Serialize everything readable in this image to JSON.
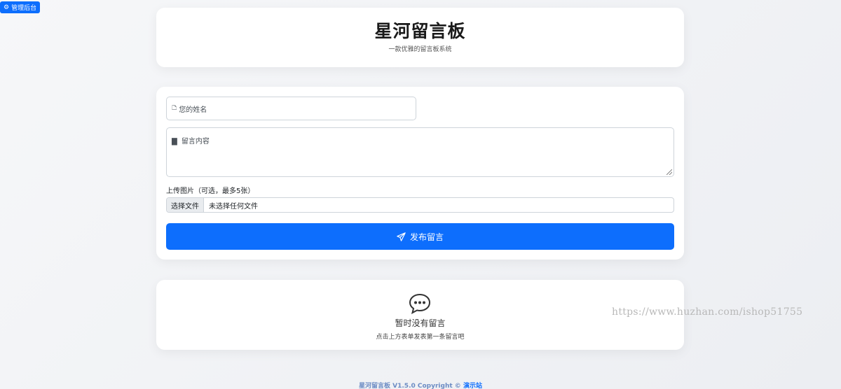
{
  "admin": {
    "label": "管理后台",
    "icon": "gear-icon"
  },
  "header": {
    "title": "星河留言板",
    "subtitle": "一款优雅的留言板系统"
  },
  "form": {
    "name_placeholder": "您的姓名",
    "name_icon": "person-icon",
    "message_placeholder": "留言内容",
    "message_icon": "chat-icon",
    "upload_label": "上传图片（可选，最多5张）",
    "file_button": "选择文件",
    "file_status": "未选择任何文件",
    "submit_label": "发布留言",
    "submit_icon": "send-icon"
  },
  "empty": {
    "icon": "chat-bubble-dots-icon",
    "title": "暂时没有留言",
    "subtitle": "点击上方表单发表第一条留言吧"
  },
  "watermark": "https://www.huzhan.com/ishop51755",
  "footer": {
    "text": "星河留言板 V1.5.0 Copyright © ",
    "link": "演示站"
  },
  "colors": {
    "primary": "#0d6efd",
    "background": "#f6f7f9"
  }
}
